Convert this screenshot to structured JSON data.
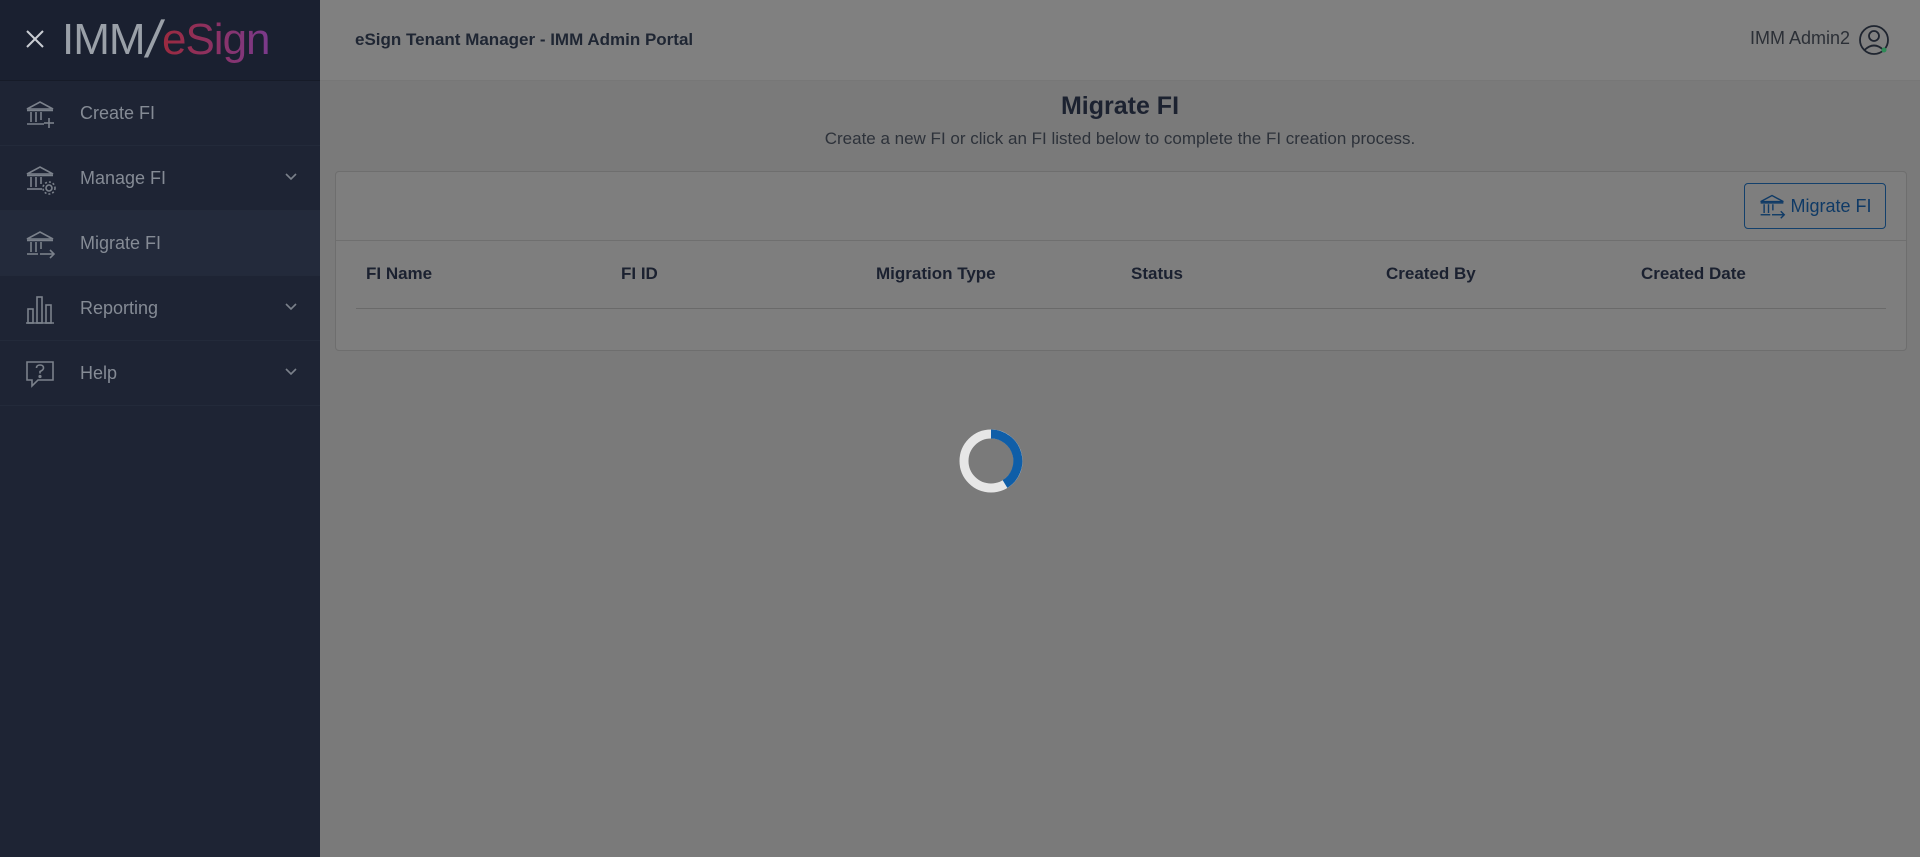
{
  "sidebar": {
    "logo_text_a": "IMM",
    "logo_slash": "/",
    "logo_text_b": "eSign",
    "items": [
      {
        "label": "Create FI",
        "icon": "bank-add-icon",
        "expandable": false,
        "active": false
      },
      {
        "label": "Manage FI",
        "icon": "bank-gear-icon",
        "expandable": true,
        "active": false
      },
      {
        "label": "Migrate FI",
        "icon": "bank-arrow-icon",
        "expandable": false,
        "active": true
      },
      {
        "label": "Reporting",
        "icon": "bar-chart-icon",
        "expandable": true,
        "active": false
      },
      {
        "label": "Help",
        "icon": "help-bubble-icon",
        "expandable": true,
        "active": false
      }
    ]
  },
  "header": {
    "title": "eSign Tenant Manager - IMM Admin Portal",
    "user_name": "IMM Admin2"
  },
  "main": {
    "title": "Migrate FI",
    "subtitle": "Create a new FI or click an FI listed below to complete the FI creation process.",
    "migrate_button_label": "Migrate FI",
    "columns": [
      "FI Name",
      "FI ID",
      "Migration Type",
      "Status",
      "Created By",
      "Created Date"
    ]
  },
  "colors": {
    "sidebar_bg": "#1e2434",
    "overlay_gray": "#7a7a7a",
    "accent_blue": "#0f5ea8"
  }
}
